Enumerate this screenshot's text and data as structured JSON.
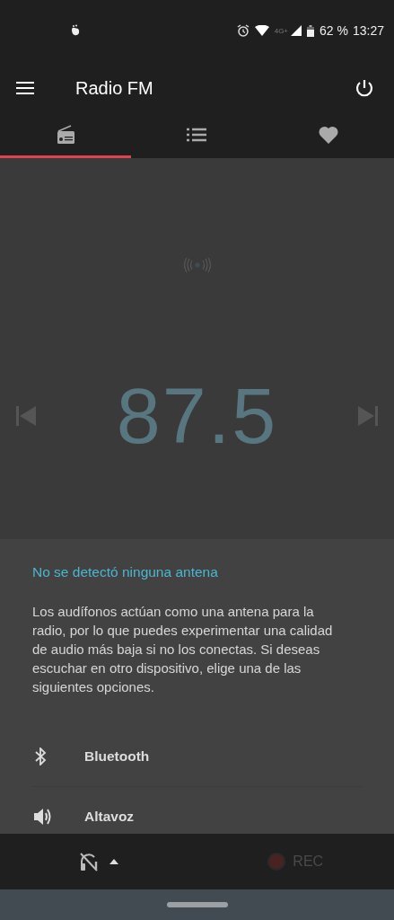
{
  "status_bar": {
    "network": "4G+",
    "battery": "62 %",
    "time": "13:27"
  },
  "app_bar": {
    "title": "Radio FM"
  },
  "tabs": [
    {
      "kind": "radio",
      "selected": true
    },
    {
      "kind": "list",
      "selected": false
    },
    {
      "kind": "favorites",
      "selected": false
    }
  ],
  "player": {
    "frequency": "87.5"
  },
  "sheet": {
    "title": "No se detectó ninguna antena",
    "body": "Los audífonos actúan como una antena para la radio, por lo que puedes experimentar una calidad de audio más baja si no los conectas. Si deseas escuchar en otro dispositivo, elige una de las siguientes opciones.",
    "options": [
      {
        "kind": "bluetooth",
        "label": "Bluetooth"
      },
      {
        "kind": "speaker",
        "label": "Altavoz"
      }
    ]
  },
  "bottom_bar": {
    "rec_label": "REC"
  }
}
